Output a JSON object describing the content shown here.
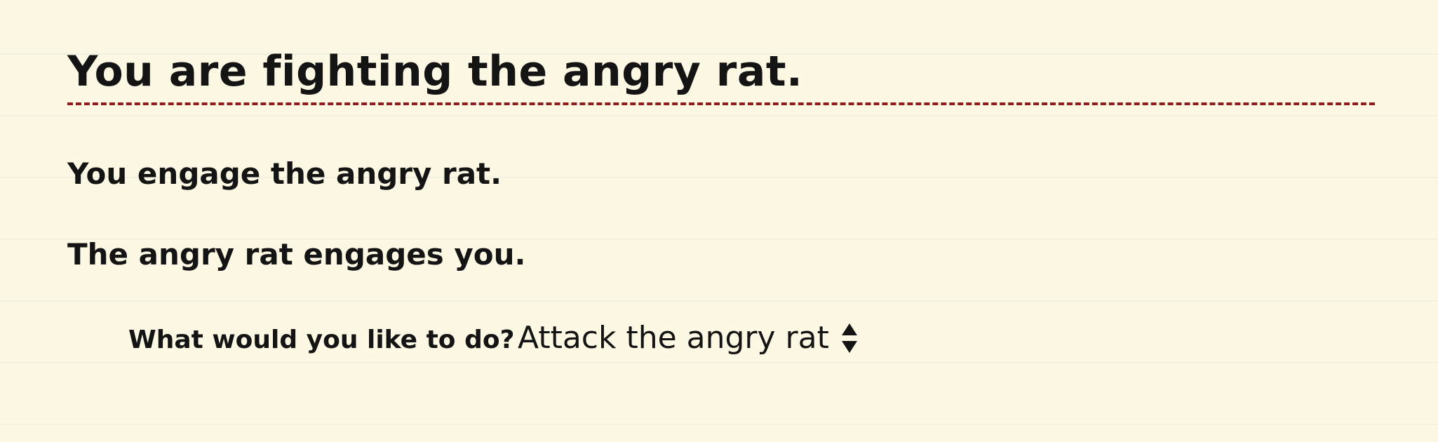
{
  "page": {
    "title": "You are fighting the angry rat.",
    "accent_color": "#8e1c1c",
    "paper_color": "#fdf8e3"
  },
  "log": [
    "You engage the angry rat.",
    "The angry rat engages you."
  ],
  "action": {
    "prompt": "What would you like to do?",
    "selected": "Attack the angry rat",
    "control_icon": "up-down-arrows-icon"
  }
}
